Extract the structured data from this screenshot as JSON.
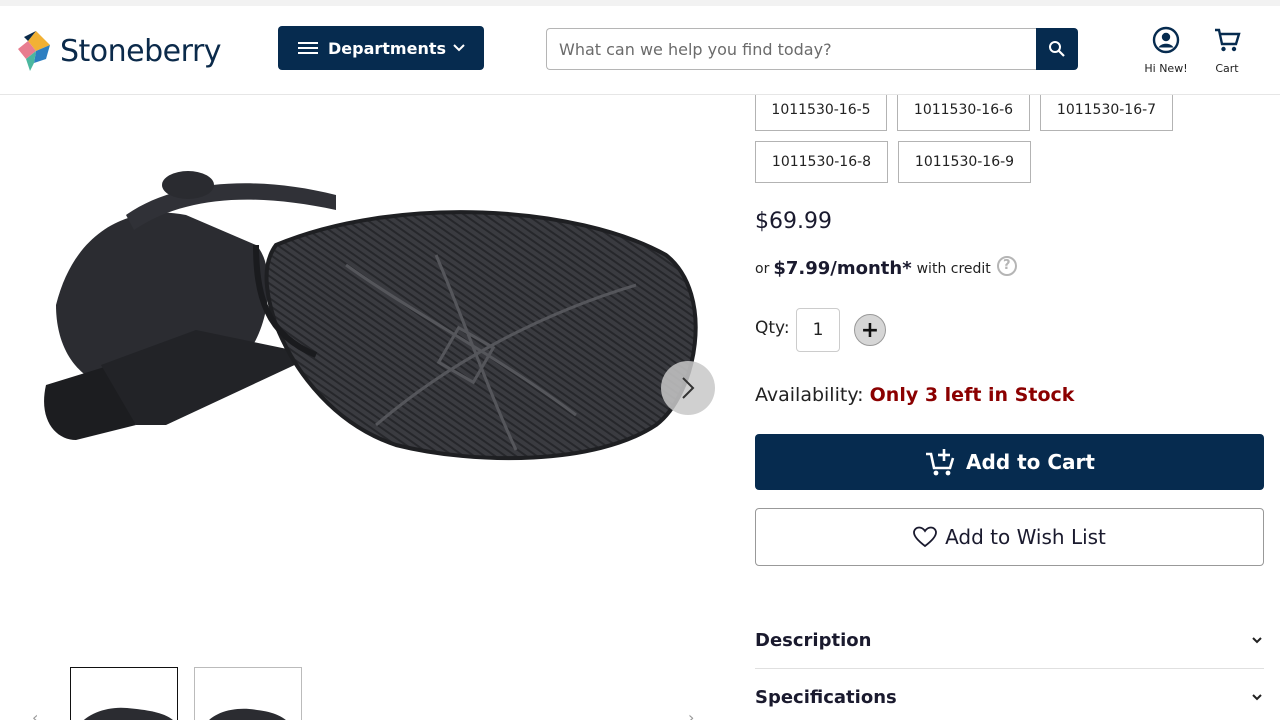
{
  "header": {
    "logo_text": "Stoneberry",
    "departments_label": "Departments",
    "search_placeholder": "What can we help you find today?",
    "account_label": "Hi New!",
    "cart_label": "Cart"
  },
  "options": {
    "skus": [
      "1011530-16-5",
      "1011530-16-6",
      "1011530-16-7",
      "1011530-16-8",
      "1011530-16-9"
    ]
  },
  "pricing": {
    "price": "$69.99",
    "credit_prefix": "or",
    "monthly": "$7.99/month*",
    "credit_suffix": "with credit",
    "help_glyph": "?"
  },
  "quantity": {
    "label": "Qty:",
    "value": "1",
    "plus_glyph": "+"
  },
  "availability": {
    "label": "Availability:",
    "status": "Only 3 left in Stock"
  },
  "actions": {
    "add_to_cart": "Add to Cart",
    "add_to_wishlist": "Add to Wish List"
  },
  "accordion": {
    "description": "Description",
    "specifications": "Specifications"
  },
  "colors": {
    "brand_navy": "#062b4f",
    "stock_red": "#8b0000"
  },
  "icons": [
    "menu-icon",
    "chevron-down-icon",
    "search-icon",
    "account-icon",
    "cart-icon",
    "chevron-right-icon",
    "add-to-cart-icon",
    "heart-icon",
    "help-icon"
  ]
}
